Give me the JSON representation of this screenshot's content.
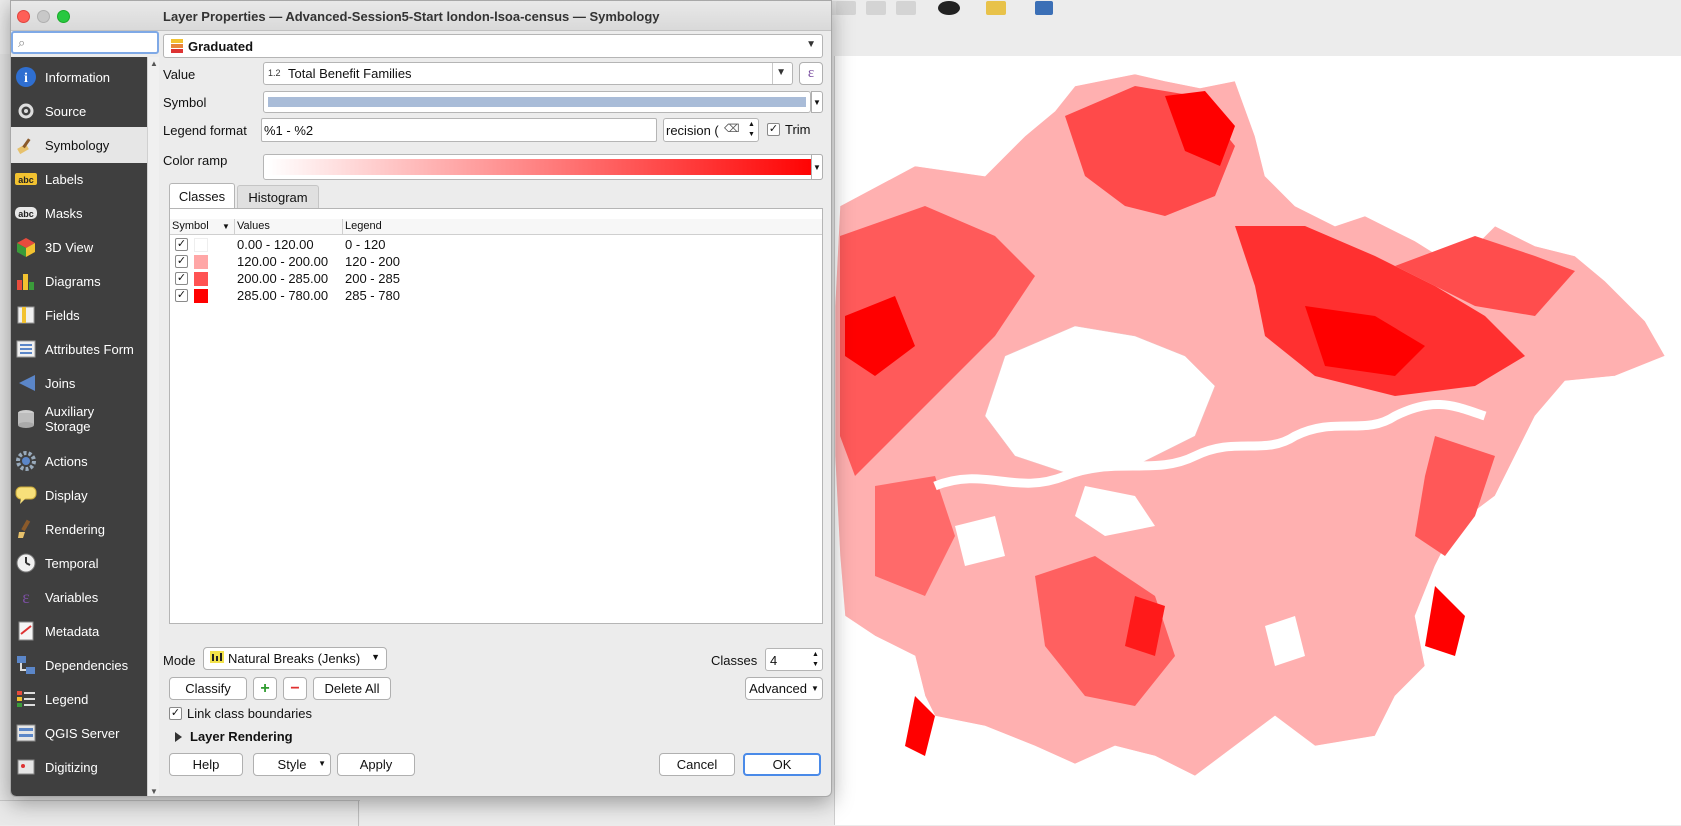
{
  "window": {
    "title": "Layer Properties — Advanced-Session5-Start london-lsoa-census — Symbology"
  },
  "search": {
    "value": "",
    "placeholder": ""
  },
  "sidebar": {
    "items": [
      {
        "label": "Information",
        "icon": "info-icon"
      },
      {
        "label": "Source",
        "icon": "source-icon"
      },
      {
        "label": "Symbology",
        "icon": "paintbrush-icon",
        "active": true
      },
      {
        "label": "Labels",
        "icon": "labels-abc-icon"
      },
      {
        "label": "Masks",
        "icon": "masks-abc-icon"
      },
      {
        "label": "3D View",
        "icon": "cube-icon"
      },
      {
        "label": "Diagrams",
        "icon": "diagram-icon"
      },
      {
        "label": "Fields",
        "icon": "fields-icon"
      },
      {
        "label": "Attributes Form",
        "icon": "form-icon"
      },
      {
        "label": "Joins",
        "icon": "joins-icon"
      },
      {
        "label": "Auxiliary\nStorage",
        "icon": "database-icon"
      },
      {
        "label": "Actions",
        "icon": "gear-icon"
      },
      {
        "label": "Display",
        "icon": "speech-bubble-icon"
      },
      {
        "label": "Rendering",
        "icon": "brush-icon"
      },
      {
        "label": "Temporal",
        "icon": "clock-icon"
      },
      {
        "label": "Variables",
        "icon": "epsilon-icon"
      },
      {
        "label": "Metadata",
        "icon": "metadata-icon"
      },
      {
        "label": "Dependencies",
        "icon": "dependencies-icon"
      },
      {
        "label": "Legend",
        "icon": "legend-icon"
      },
      {
        "label": "QGIS Server",
        "icon": "server-icon"
      },
      {
        "label": "Digitizing",
        "icon": "digitizing-icon"
      }
    ]
  },
  "renderer": {
    "type": "Graduated"
  },
  "value": {
    "label": "Value",
    "type_badge": "1.2",
    "field": "Total Benefit Families",
    "expr_icon": "ε"
  },
  "symbol": {
    "label": "Symbol",
    "color": "#a9bcd8"
  },
  "legend_format": {
    "label": "Legend format",
    "value": "%1 - %2",
    "precision_text": "recision (",
    "trim_label": "Trim",
    "trim_checked": true
  },
  "color_ramp": {
    "label": "Color ramp",
    "from": "#ffffff",
    "to": "#ff0000"
  },
  "tabs": {
    "classes": "Classes",
    "histogram": "Histogram"
  },
  "table": {
    "headers": {
      "symbol": "Symbol",
      "values": "Values",
      "legend": "Legend"
    },
    "rows": [
      {
        "checked": true,
        "color": "#ffffff",
        "values": "0.00 - 120.00",
        "legend": "0 - 120"
      },
      {
        "checked": true,
        "color": "#ffa6a6",
        "values": "120.00 - 200.00",
        "legend": "120 - 200"
      },
      {
        "checked": true,
        "color": "#ff5252",
        "values": "200.00 - 285.00",
        "legend": "200 - 285"
      },
      {
        "checked": true,
        "color": "#ff0000",
        "values": "285.00 - 780.00",
        "legend": "285 - 780"
      }
    ]
  },
  "mode": {
    "label": "Mode",
    "value": "Natural Breaks (Jenks)"
  },
  "classes": {
    "label": "Classes",
    "value": "4"
  },
  "buttons": {
    "classify": "Classify",
    "add": "+",
    "remove": "−",
    "delete_all": "Delete All",
    "advanced": "Advanced",
    "help": "Help",
    "style": "Style",
    "apply": "Apply",
    "cancel": "Cancel",
    "ok": "OK"
  },
  "link_class_boundaries": {
    "label": "Link class boundaries",
    "checked": true
  },
  "layer_rendering": {
    "label": "Layer Rendering"
  }
}
